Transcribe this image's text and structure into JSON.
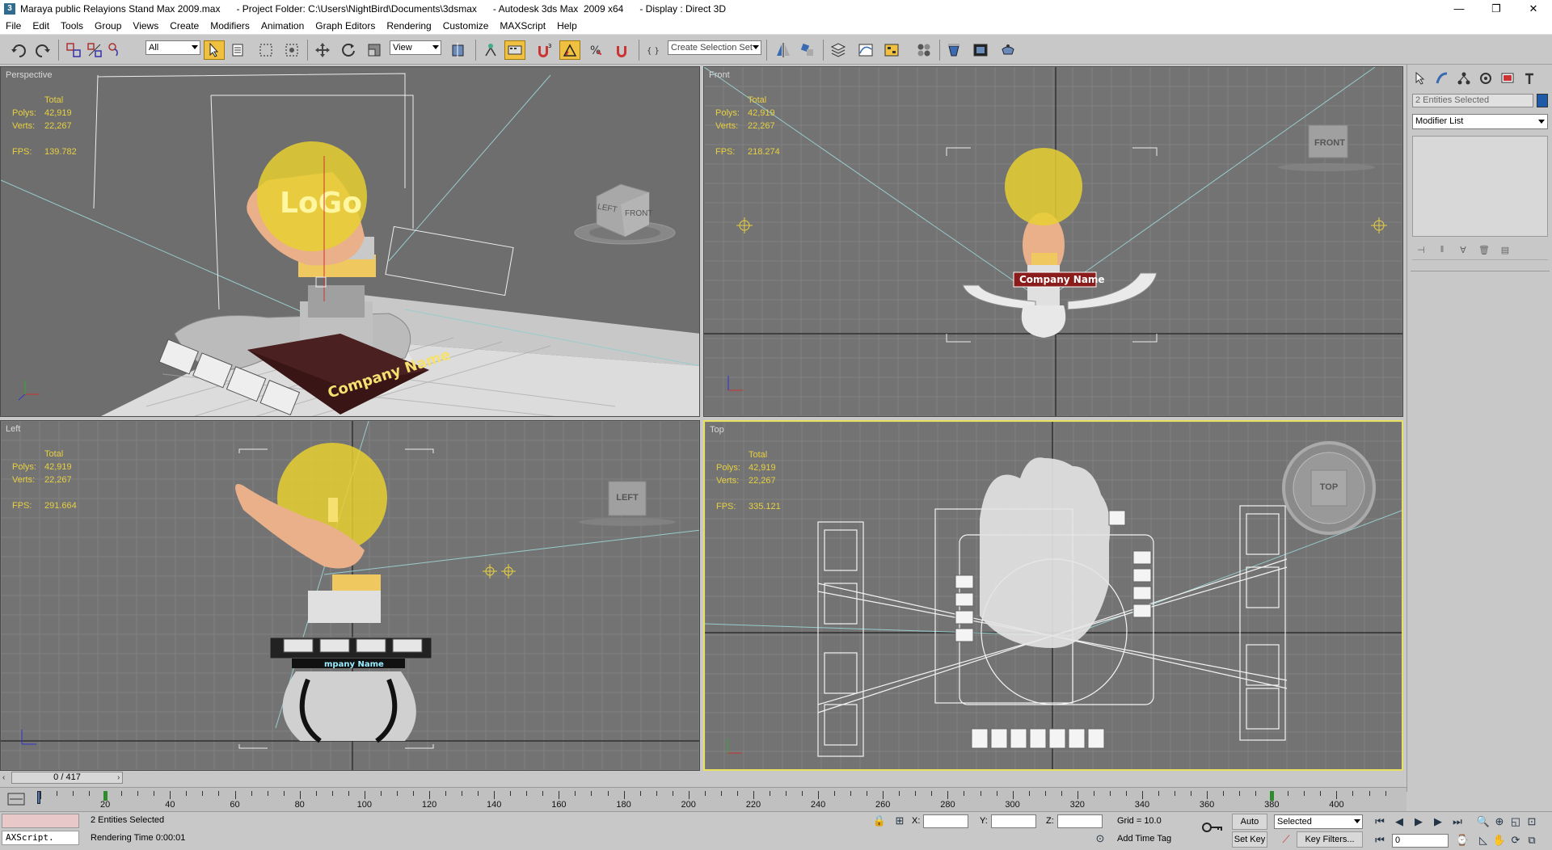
{
  "window": {
    "title": "Maraya public Relayions Stand Max 2009.max      - Project Folder: C:\\Users\\NightBird\\Documents\\3dsmax      - Autodesk 3ds Max  2009 x64      - Display : Direct 3D",
    "minimize": "—",
    "maximize": "❐",
    "close": "✕"
  },
  "menu": [
    "File",
    "Edit",
    "Tools",
    "Group",
    "Views",
    "Create",
    "Modifiers",
    "Animation",
    "Graph Editors",
    "Rendering",
    "Customize",
    "MAXScript",
    "Help"
  ],
  "toolbar": {
    "filter_value": "All",
    "coord_system": "View",
    "selection_set_placeholder": "Create Selection Set"
  },
  "viewports": [
    {
      "label": "Perspective",
      "total": "Total",
      "polys_label": "Polys:",
      "polys": "42,919",
      "verts_label": "Verts:",
      "verts": "22,267",
      "fps_label": "FPS:",
      "fps": "139.782",
      "viewcube": [
        "LEFT",
        "FRONT"
      ],
      "company": "Company Name",
      "logo": "LoGo"
    },
    {
      "label": "Front",
      "total": "Total",
      "polys_label": "Polys:",
      "polys": "42,919",
      "verts_label": "Verts:",
      "verts": "22,267",
      "fps_label": "FPS:",
      "fps": "218.274",
      "viewcube": [
        "FRONT"
      ],
      "company": "Company Name"
    },
    {
      "label": "Left",
      "total": "Total",
      "polys_label": "Polys:",
      "polys": "42,919",
      "verts_label": "Verts:",
      "verts": "22,267",
      "fps_label": "FPS:",
      "fps": "291.664",
      "viewcube": [
        "LEFT"
      ],
      "company": "mpany Name"
    },
    {
      "label": "Top",
      "total": "Total",
      "polys_label": "Polys:",
      "polys": "42,919",
      "verts_label": "Verts:",
      "verts": "22,267",
      "fps_label": "FPS:",
      "fps": "335.121",
      "viewcube": [
        "TOP"
      ]
    }
  ],
  "command_panel": {
    "selection_name": "2 Entities Selected",
    "modifier_list": "Modifier List",
    "selection_color": "#1e5aa8"
  },
  "time": {
    "slider": "0 / 417",
    "frames": [
      20,
      40,
      60,
      80,
      100,
      120,
      140,
      160,
      180,
      200,
      220,
      240,
      260,
      280,
      300,
      320,
      340,
      360,
      380,
      400
    ],
    "range_end": 417,
    "current_frame": 0,
    "key_frames": [
      20,
      380
    ]
  },
  "status": {
    "maxscript": "AXScript.",
    "selected": "2 Entities Selected",
    "rendering_time": "Rendering Time  0:00:01",
    "x_label": "X:",
    "y_label": "Y:",
    "z_label": "Z:",
    "grid": "Grid = 10.0",
    "add_time_tag": "Add Time Tag",
    "auto_key": "Auto Key",
    "set_key": "Set Key",
    "selected_dropdown": "Selected",
    "key_filters": "Key Filters...",
    "frame_value": "0"
  },
  "colors": {
    "viewport_bg": "#737373",
    "active_border": "#e8e060",
    "stats_text": "#e8d040",
    "toolbar_active": "#f0c040"
  }
}
